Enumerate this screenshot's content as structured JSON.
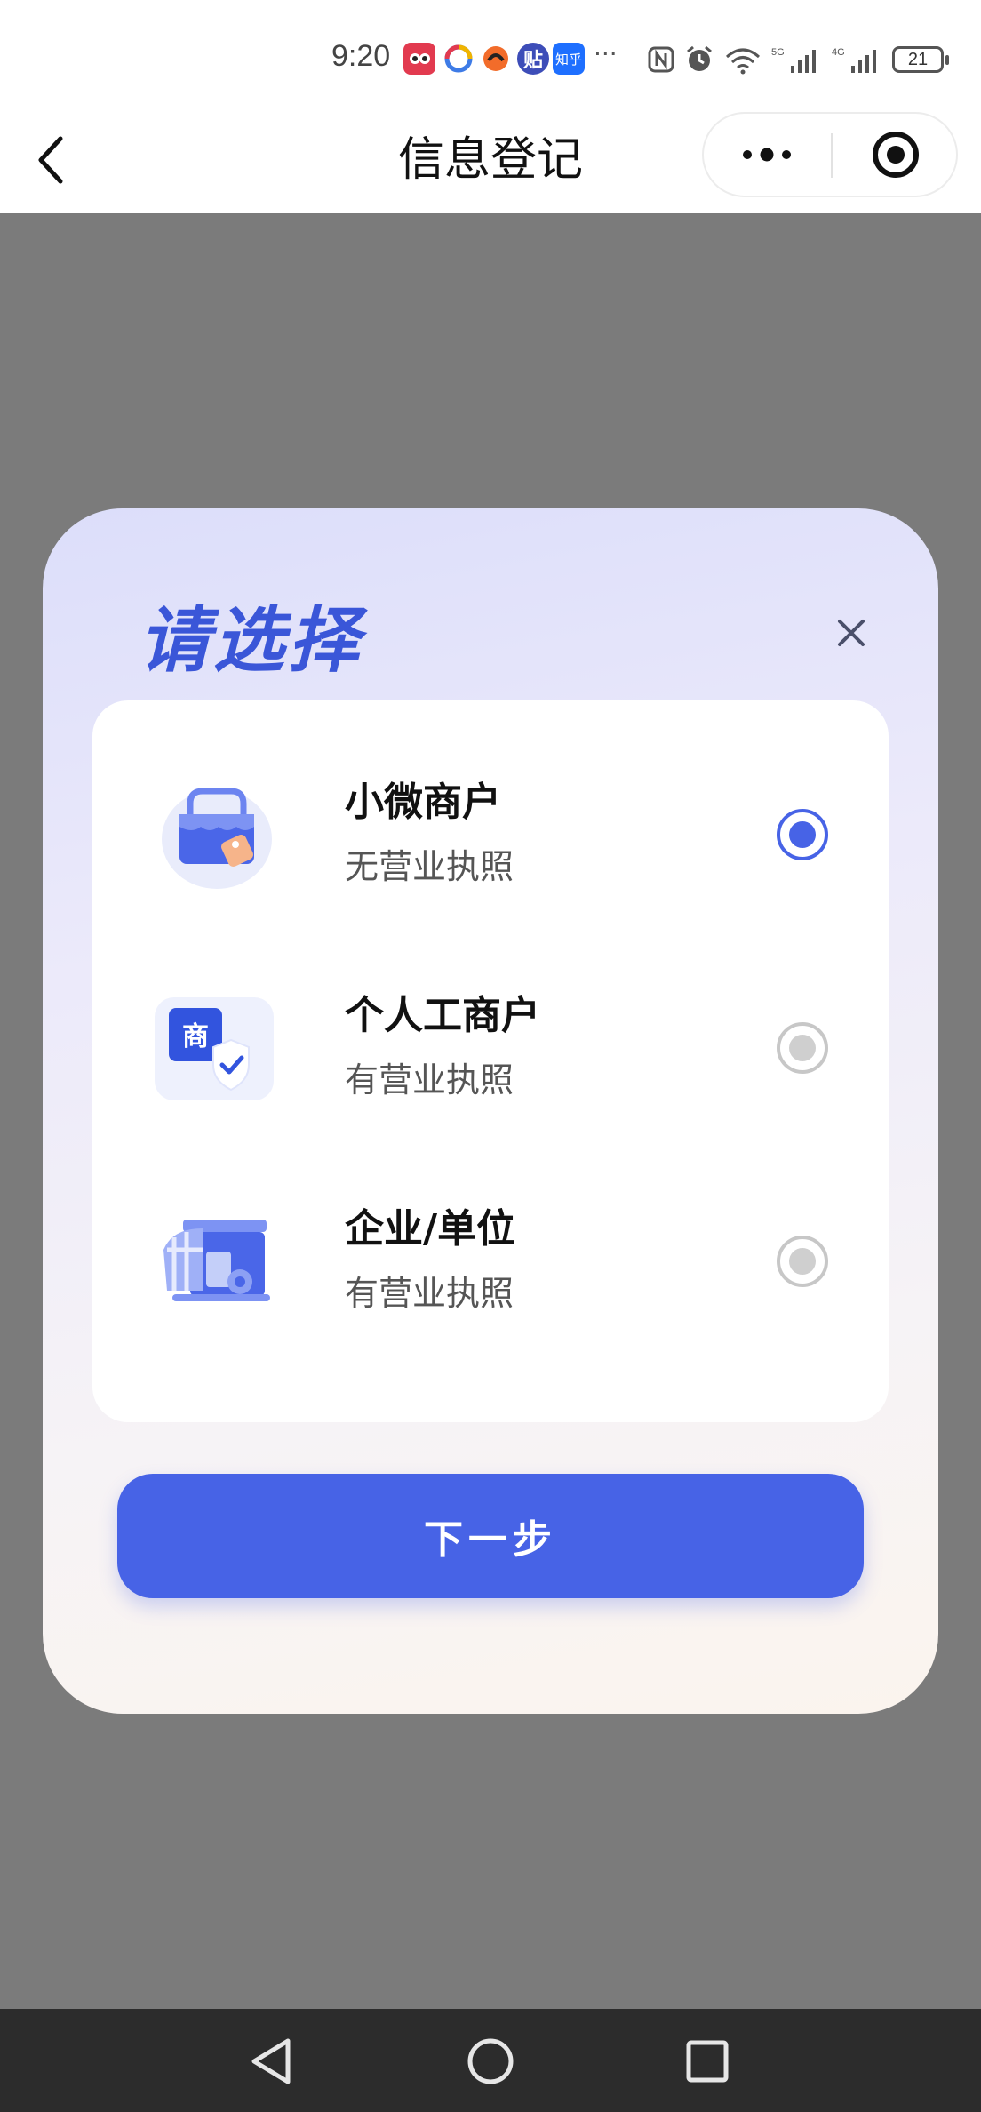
{
  "status_bar": {
    "time": "9:20",
    "more_indicator": "···",
    "battery_level": "21",
    "network_labels": [
      "5G",
      "4G"
    ],
    "notification_icons": [
      "app-red-icon",
      "app-multicolor-icon",
      "app-orange-icon",
      "baidu-tieba-icon",
      "zhihu-icon"
    ],
    "zhihu_label": "知乎",
    "tieba_label": "贴"
  },
  "nav": {
    "title": "信息登记"
  },
  "dialog": {
    "title": "请选择",
    "next_label": "下一步",
    "options": [
      {
        "name": "小微商户",
        "desc": "无营业执照",
        "checked": true,
        "icon": "shop-bag-icon"
      },
      {
        "name": "个人工商户",
        "desc": "有营业执照",
        "checked": false,
        "icon": "merchant-badge-icon",
        "icon_text": "商"
      },
      {
        "name": "企业/单位",
        "desc": "有营业执照",
        "checked": false,
        "icon": "storefront-icon"
      }
    ]
  },
  "colors": {
    "accent": "#4763e6",
    "title_blue": "#3a56d8",
    "overlay": "#7b7b7b"
  }
}
